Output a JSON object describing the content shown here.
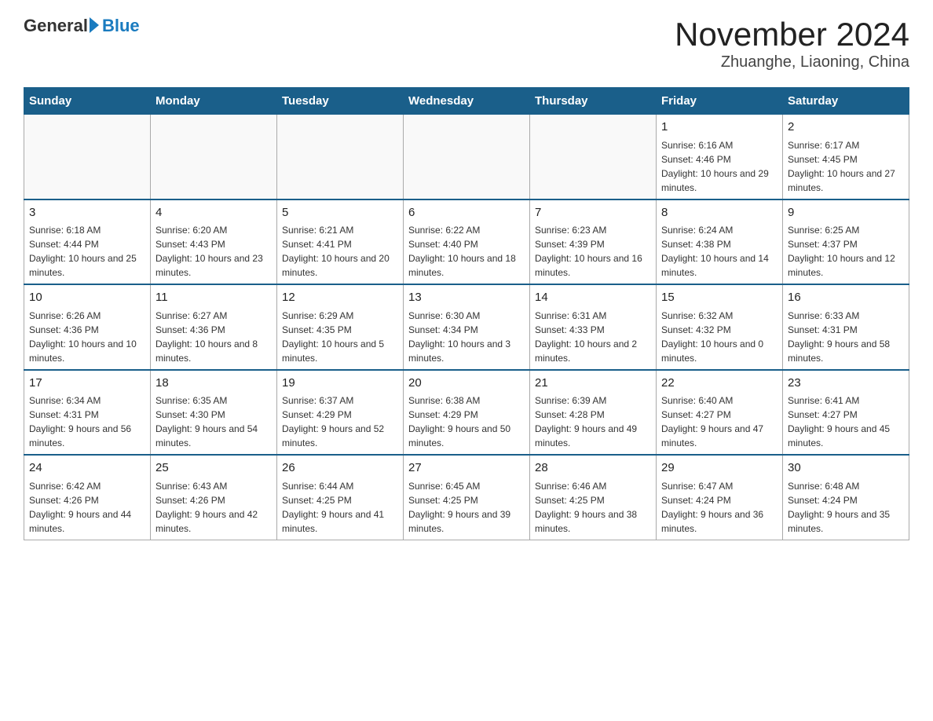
{
  "header": {
    "logo_general": "General",
    "logo_blue": "Blue",
    "month_title": "November 2024",
    "location": "Zhuanghe, Liaoning, China"
  },
  "days_of_week": [
    "Sunday",
    "Monday",
    "Tuesday",
    "Wednesday",
    "Thursday",
    "Friday",
    "Saturday"
  ],
  "weeks": [
    [
      {
        "day": "",
        "info": ""
      },
      {
        "day": "",
        "info": ""
      },
      {
        "day": "",
        "info": ""
      },
      {
        "day": "",
        "info": ""
      },
      {
        "day": "",
        "info": ""
      },
      {
        "day": "1",
        "info": "Sunrise: 6:16 AM\nSunset: 4:46 PM\nDaylight: 10 hours and 29 minutes."
      },
      {
        "day": "2",
        "info": "Sunrise: 6:17 AM\nSunset: 4:45 PM\nDaylight: 10 hours and 27 minutes."
      }
    ],
    [
      {
        "day": "3",
        "info": "Sunrise: 6:18 AM\nSunset: 4:44 PM\nDaylight: 10 hours and 25 minutes."
      },
      {
        "day": "4",
        "info": "Sunrise: 6:20 AM\nSunset: 4:43 PM\nDaylight: 10 hours and 23 minutes."
      },
      {
        "day": "5",
        "info": "Sunrise: 6:21 AM\nSunset: 4:41 PM\nDaylight: 10 hours and 20 minutes."
      },
      {
        "day": "6",
        "info": "Sunrise: 6:22 AM\nSunset: 4:40 PM\nDaylight: 10 hours and 18 minutes."
      },
      {
        "day": "7",
        "info": "Sunrise: 6:23 AM\nSunset: 4:39 PM\nDaylight: 10 hours and 16 minutes."
      },
      {
        "day": "8",
        "info": "Sunrise: 6:24 AM\nSunset: 4:38 PM\nDaylight: 10 hours and 14 minutes."
      },
      {
        "day": "9",
        "info": "Sunrise: 6:25 AM\nSunset: 4:37 PM\nDaylight: 10 hours and 12 minutes."
      }
    ],
    [
      {
        "day": "10",
        "info": "Sunrise: 6:26 AM\nSunset: 4:36 PM\nDaylight: 10 hours and 10 minutes."
      },
      {
        "day": "11",
        "info": "Sunrise: 6:27 AM\nSunset: 4:36 PM\nDaylight: 10 hours and 8 minutes."
      },
      {
        "day": "12",
        "info": "Sunrise: 6:29 AM\nSunset: 4:35 PM\nDaylight: 10 hours and 5 minutes."
      },
      {
        "day": "13",
        "info": "Sunrise: 6:30 AM\nSunset: 4:34 PM\nDaylight: 10 hours and 3 minutes."
      },
      {
        "day": "14",
        "info": "Sunrise: 6:31 AM\nSunset: 4:33 PM\nDaylight: 10 hours and 2 minutes."
      },
      {
        "day": "15",
        "info": "Sunrise: 6:32 AM\nSunset: 4:32 PM\nDaylight: 10 hours and 0 minutes."
      },
      {
        "day": "16",
        "info": "Sunrise: 6:33 AM\nSunset: 4:31 PM\nDaylight: 9 hours and 58 minutes."
      }
    ],
    [
      {
        "day": "17",
        "info": "Sunrise: 6:34 AM\nSunset: 4:31 PM\nDaylight: 9 hours and 56 minutes."
      },
      {
        "day": "18",
        "info": "Sunrise: 6:35 AM\nSunset: 4:30 PM\nDaylight: 9 hours and 54 minutes."
      },
      {
        "day": "19",
        "info": "Sunrise: 6:37 AM\nSunset: 4:29 PM\nDaylight: 9 hours and 52 minutes."
      },
      {
        "day": "20",
        "info": "Sunrise: 6:38 AM\nSunset: 4:29 PM\nDaylight: 9 hours and 50 minutes."
      },
      {
        "day": "21",
        "info": "Sunrise: 6:39 AM\nSunset: 4:28 PM\nDaylight: 9 hours and 49 minutes."
      },
      {
        "day": "22",
        "info": "Sunrise: 6:40 AM\nSunset: 4:27 PM\nDaylight: 9 hours and 47 minutes."
      },
      {
        "day": "23",
        "info": "Sunrise: 6:41 AM\nSunset: 4:27 PM\nDaylight: 9 hours and 45 minutes."
      }
    ],
    [
      {
        "day": "24",
        "info": "Sunrise: 6:42 AM\nSunset: 4:26 PM\nDaylight: 9 hours and 44 minutes."
      },
      {
        "day": "25",
        "info": "Sunrise: 6:43 AM\nSunset: 4:26 PM\nDaylight: 9 hours and 42 minutes."
      },
      {
        "day": "26",
        "info": "Sunrise: 6:44 AM\nSunset: 4:25 PM\nDaylight: 9 hours and 41 minutes."
      },
      {
        "day": "27",
        "info": "Sunrise: 6:45 AM\nSunset: 4:25 PM\nDaylight: 9 hours and 39 minutes."
      },
      {
        "day": "28",
        "info": "Sunrise: 6:46 AM\nSunset: 4:25 PM\nDaylight: 9 hours and 38 minutes."
      },
      {
        "day": "29",
        "info": "Sunrise: 6:47 AM\nSunset: 4:24 PM\nDaylight: 9 hours and 36 minutes."
      },
      {
        "day": "30",
        "info": "Sunrise: 6:48 AM\nSunset: 4:24 PM\nDaylight: 9 hours and 35 minutes."
      }
    ]
  ]
}
